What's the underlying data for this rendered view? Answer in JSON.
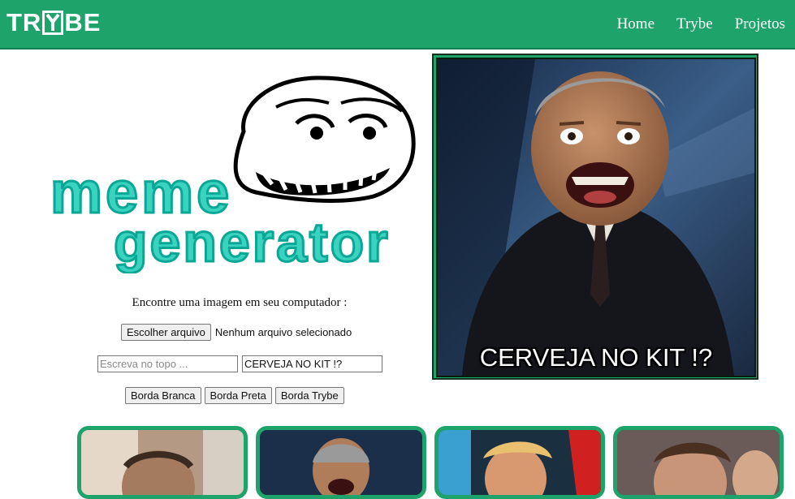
{
  "header": {
    "logo_text": "TRYBE",
    "nav": [
      "Home",
      "Trybe",
      "Projetos"
    ],
    "bg_color": "#1ea46a"
  },
  "meme_logo": {
    "line1": "meme",
    "line2": "generator"
  },
  "controls": {
    "prompt": "Encontre uma imagem em seu computador :",
    "file_button": "Escolher arquivo",
    "file_status": "Nenhum arquivo selecionado",
    "top_text_placeholder": "Escreva no topo ...",
    "top_text_value": "",
    "bottom_text_value": "CERVEJA NO KIT !?",
    "border_buttons": [
      "Borda Branca",
      "Borda Preta",
      "Borda Trybe"
    ]
  },
  "preview": {
    "meme_text": "CERVEJA NO KIT !?"
  },
  "thumbnails": [
    {
      "subject": "man-face-1"
    },
    {
      "subject": "laughing-man-suit"
    },
    {
      "subject": "trump"
    },
    {
      "subject": "faustao"
    }
  ]
}
